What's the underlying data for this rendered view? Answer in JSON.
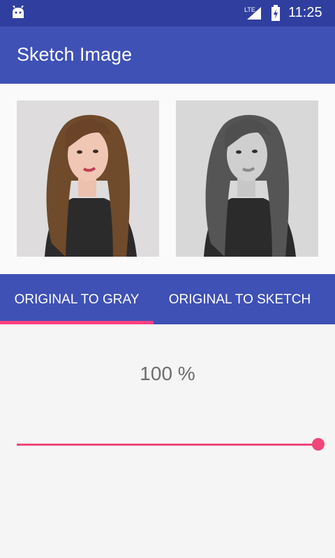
{
  "status_bar": {
    "time": "11:25",
    "network_label": "LTE",
    "icons": [
      "android-icon",
      "lte-signal-icon",
      "battery-charging-icon"
    ]
  },
  "app_bar": {
    "title": "Sketch Image"
  },
  "images": {
    "left": "original-photo",
    "right": "gray-photo"
  },
  "tabs": [
    {
      "label": "ORIGINAL TO GRAY",
      "selected": true
    },
    {
      "label": "ORIGINAL TO SKETCH",
      "selected": false
    }
  ],
  "slider": {
    "percent_text": "100 %",
    "value": 100
  },
  "colors": {
    "status_bar": "#303f9f",
    "app_bar": "#3f51b5",
    "accent": "#ff4081",
    "slider": "#f0467b"
  }
}
